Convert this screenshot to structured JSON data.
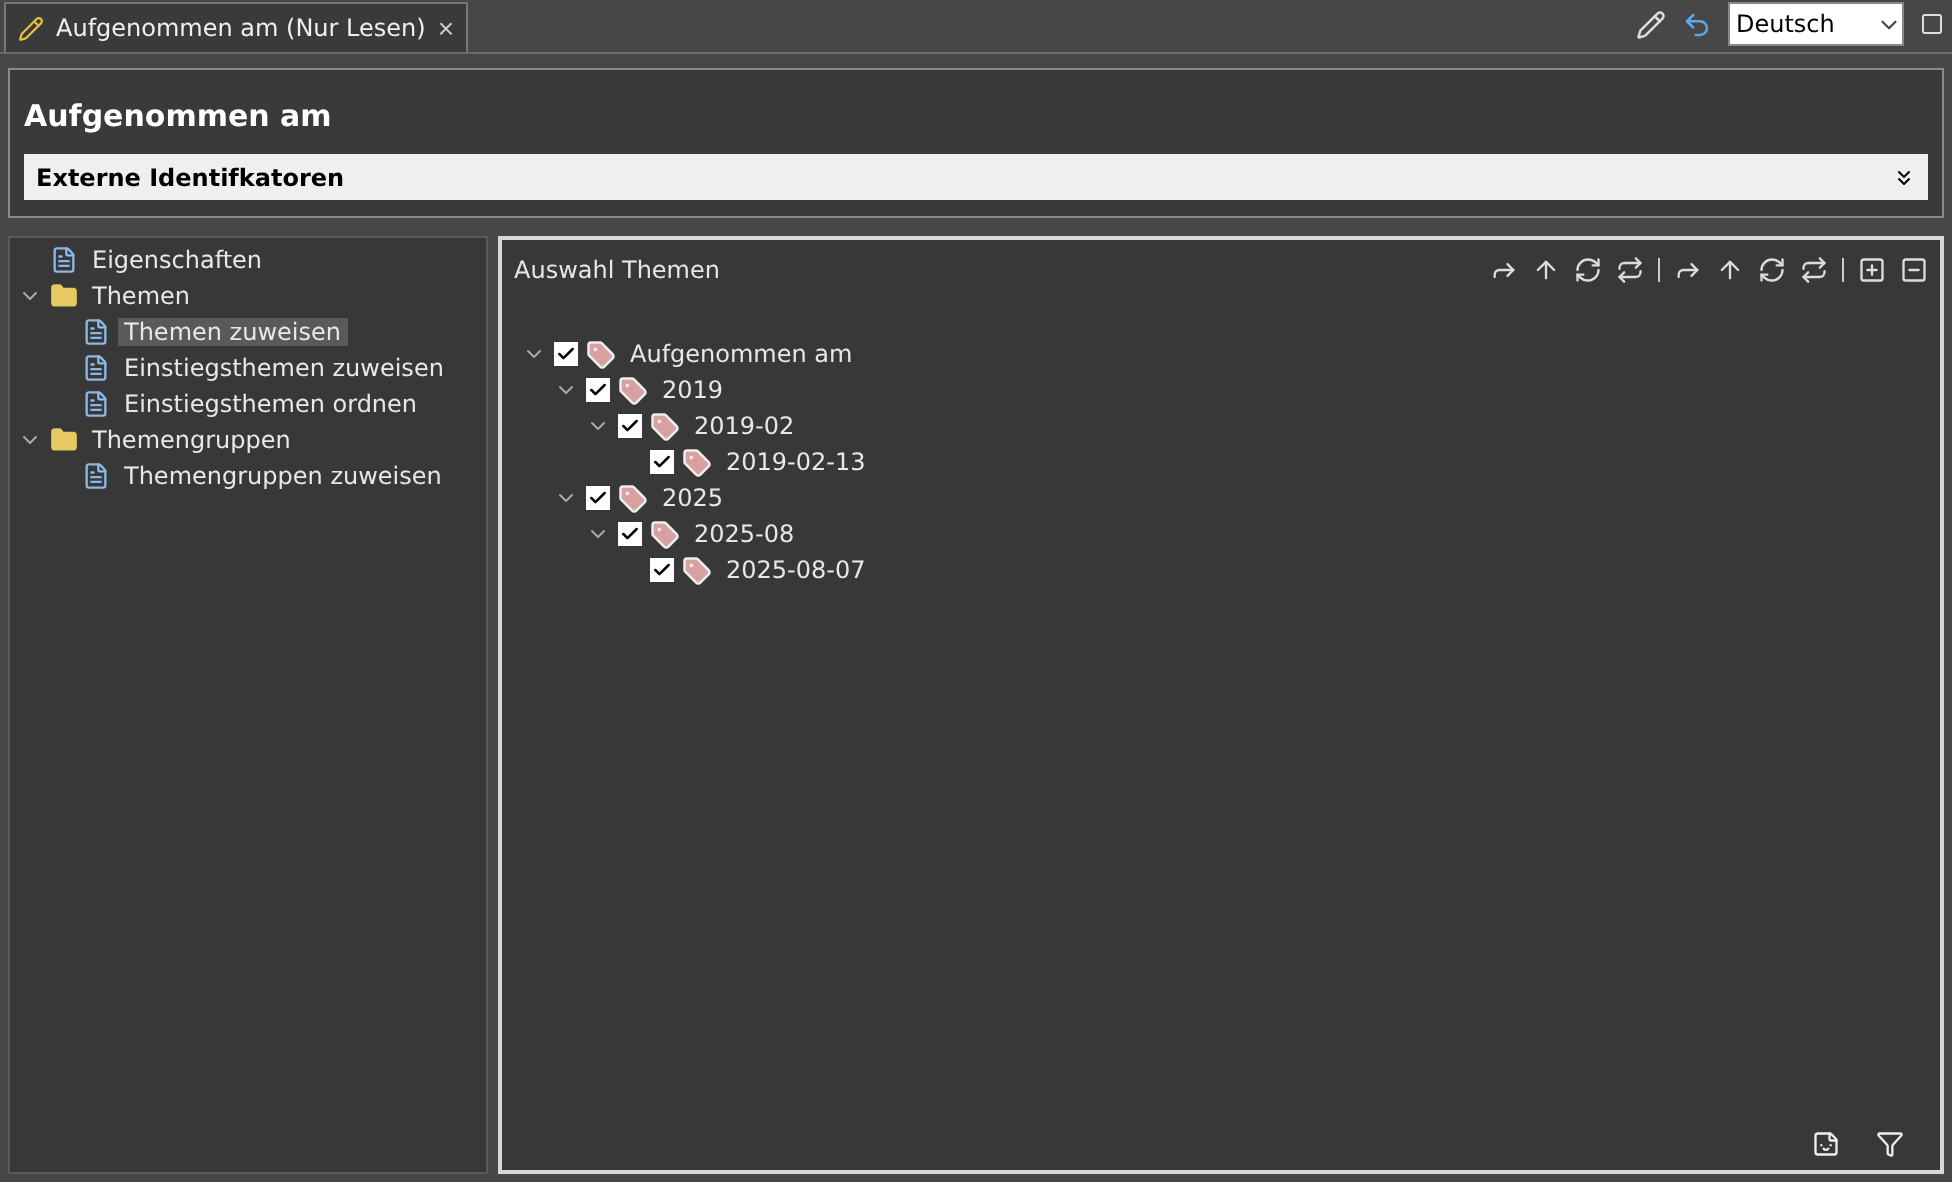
{
  "tab": {
    "title": "Aufgenommen am (Nur Lesen)",
    "close": "×"
  },
  "language": {
    "value": "Deutsch"
  },
  "header": {
    "title": "Aufgenommen am",
    "section": {
      "label": "Externe Identifkatoren",
      "expanded": false
    }
  },
  "nav": [
    {
      "label": "Eigenschaften",
      "kind": "page",
      "selected": false
    },
    {
      "label": "Themen",
      "kind": "folder",
      "expanded": true,
      "children": [
        {
          "label": "Themen zuweisen",
          "kind": "page",
          "selected": true
        },
        {
          "label": "Einstiegsthemen zuweisen",
          "kind": "page",
          "selected": false
        },
        {
          "label": "Einstiegsthemen ordnen",
          "kind": "page",
          "selected": false
        }
      ]
    },
    {
      "label": "Themengruppen",
      "kind": "folder",
      "expanded": true,
      "children": [
        {
          "label": "Themengruppen zuweisen",
          "kind": "page",
          "selected": false
        }
      ]
    }
  ],
  "panel": {
    "title": "Auswahl Themen",
    "tree": [
      {
        "label": "Aufgenommen am",
        "checked": true,
        "expanded": true,
        "children": [
          {
            "label": "2019",
            "checked": true,
            "expanded": true,
            "children": [
              {
                "label": "2019-02",
                "checked": true,
                "expanded": true,
                "children": [
                  {
                    "label": "2019-02-13",
                    "checked": true
                  }
                ]
              }
            ]
          },
          {
            "label": "2025",
            "checked": true,
            "expanded": true,
            "children": [
              {
                "label": "2025-08",
                "checked": true,
                "expanded": true,
                "children": [
                  {
                    "label": "2025-08-07",
                    "checked": true
                  }
                ]
              }
            ]
          }
        ]
      }
    ]
  }
}
